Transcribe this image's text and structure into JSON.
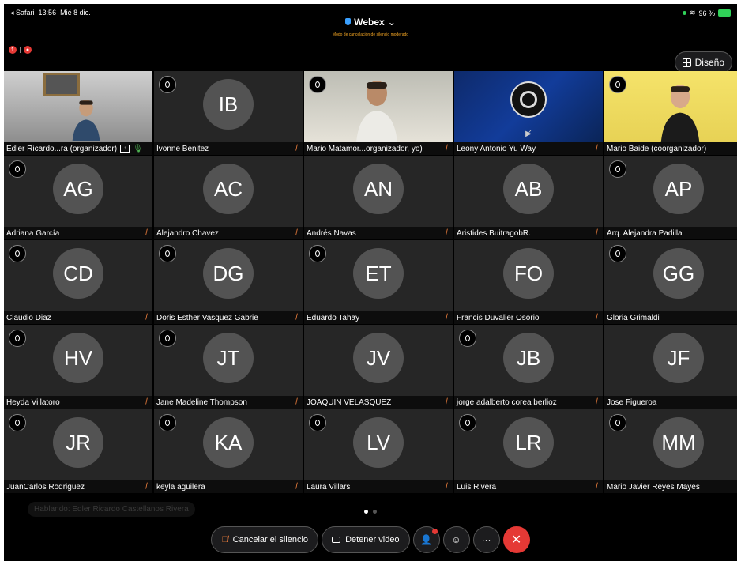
{
  "status_bar": {
    "back": "◂ Safari",
    "time": "13:56",
    "date": "Mié 8 dic.",
    "battery": "96 %"
  },
  "header": {
    "title": "Webex",
    "subtitle": "Modo de cancelación de silencio moderado",
    "indicator_count": "1"
  },
  "layout_button": {
    "label": "Diseño"
  },
  "colors": {
    "accent_mute": "#e57a3c",
    "leave_red": "#e53935",
    "active_border": "#4fd1c5",
    "subtitle_orange": "#f5a623"
  },
  "participants": [
    {
      "name": "Edler Ricardo...ra (organizador)",
      "kind": "video-office",
      "badge": false,
      "active": true,
      "muted": false
    },
    {
      "name": "Ivonne Benitez",
      "initials": "IB",
      "badge": true,
      "muted": true
    },
    {
      "name": "Mario Matamor...organizador, yo)",
      "kind": "video-room",
      "badge": true,
      "muted": true
    },
    {
      "name": "Leony Antonio Yu Way",
      "kind": "video-obs",
      "badge": false,
      "muted": true
    },
    {
      "name": "Mario Baide (coorganizador)",
      "kind": "video-yellow",
      "badge": true,
      "muted": false
    },
    {
      "name": "Adriana García",
      "initials": "AG",
      "badge": true,
      "muted": true
    },
    {
      "name": "Alejandro Chavez",
      "initials": "AC",
      "badge": false,
      "muted": true
    },
    {
      "name": "Andrés Navas",
      "initials": "AN",
      "badge": false,
      "muted": true
    },
    {
      "name": "Aristides BuitragobR.",
      "initials": "AB",
      "badge": false,
      "muted": true
    },
    {
      "name": "Arq. Alejandra Padilla",
      "initials": "AP",
      "badge": true,
      "muted": false
    },
    {
      "name": "Claudio Diaz",
      "initials": "CD",
      "badge": true,
      "muted": true
    },
    {
      "name": "Doris Esther Vasquez Gabrie",
      "initials": "DG",
      "badge": true,
      "muted": true
    },
    {
      "name": "Eduardo Tahay",
      "initials": "ET",
      "badge": true,
      "muted": true
    },
    {
      "name": "Francis Duvalier Osorio",
      "initials": "FO",
      "badge": false,
      "muted": true
    },
    {
      "name": "Gloria Grimaldi",
      "initials": "GG",
      "badge": true,
      "muted": false
    },
    {
      "name": "Heyda Villatoro",
      "initials": "HV",
      "badge": true,
      "muted": true
    },
    {
      "name": "Jane Madeline Thompson",
      "initials": "JT",
      "badge": true,
      "muted": true
    },
    {
      "name": "JOAQUIN VELASQUEZ",
      "initials": "JV",
      "badge": false,
      "muted": true
    },
    {
      "name": "jorge adalberto corea berlioz",
      "initials": "JB",
      "badge": true,
      "muted": true
    },
    {
      "name": "Jose Figueroa",
      "initials": "JF",
      "badge": false,
      "muted": false
    },
    {
      "name": "JuanCarlos Rodriguez",
      "initials": "JR",
      "badge": true,
      "muted": true
    },
    {
      "name": "keyla aguilera",
      "initials": "KA",
      "badge": true,
      "muted": true
    },
    {
      "name": "Laura Villars",
      "initials": "LV",
      "badge": true,
      "muted": true
    },
    {
      "name": "Luis Rivera",
      "initials": "LR",
      "badge": true,
      "muted": true
    },
    {
      "name": "Mario Javier Reyes Mayes",
      "initials": "MM",
      "badge": true,
      "muted": false
    }
  ],
  "speaking": "Hablando: Edler Ricardo Castellanos Rivera",
  "pager": {
    "pages": 2,
    "current": 0
  },
  "controls": {
    "unmute_label": "Cancelar el silencio",
    "video_label": "Detener video",
    "more_label": "···",
    "leave_label": "✕"
  }
}
